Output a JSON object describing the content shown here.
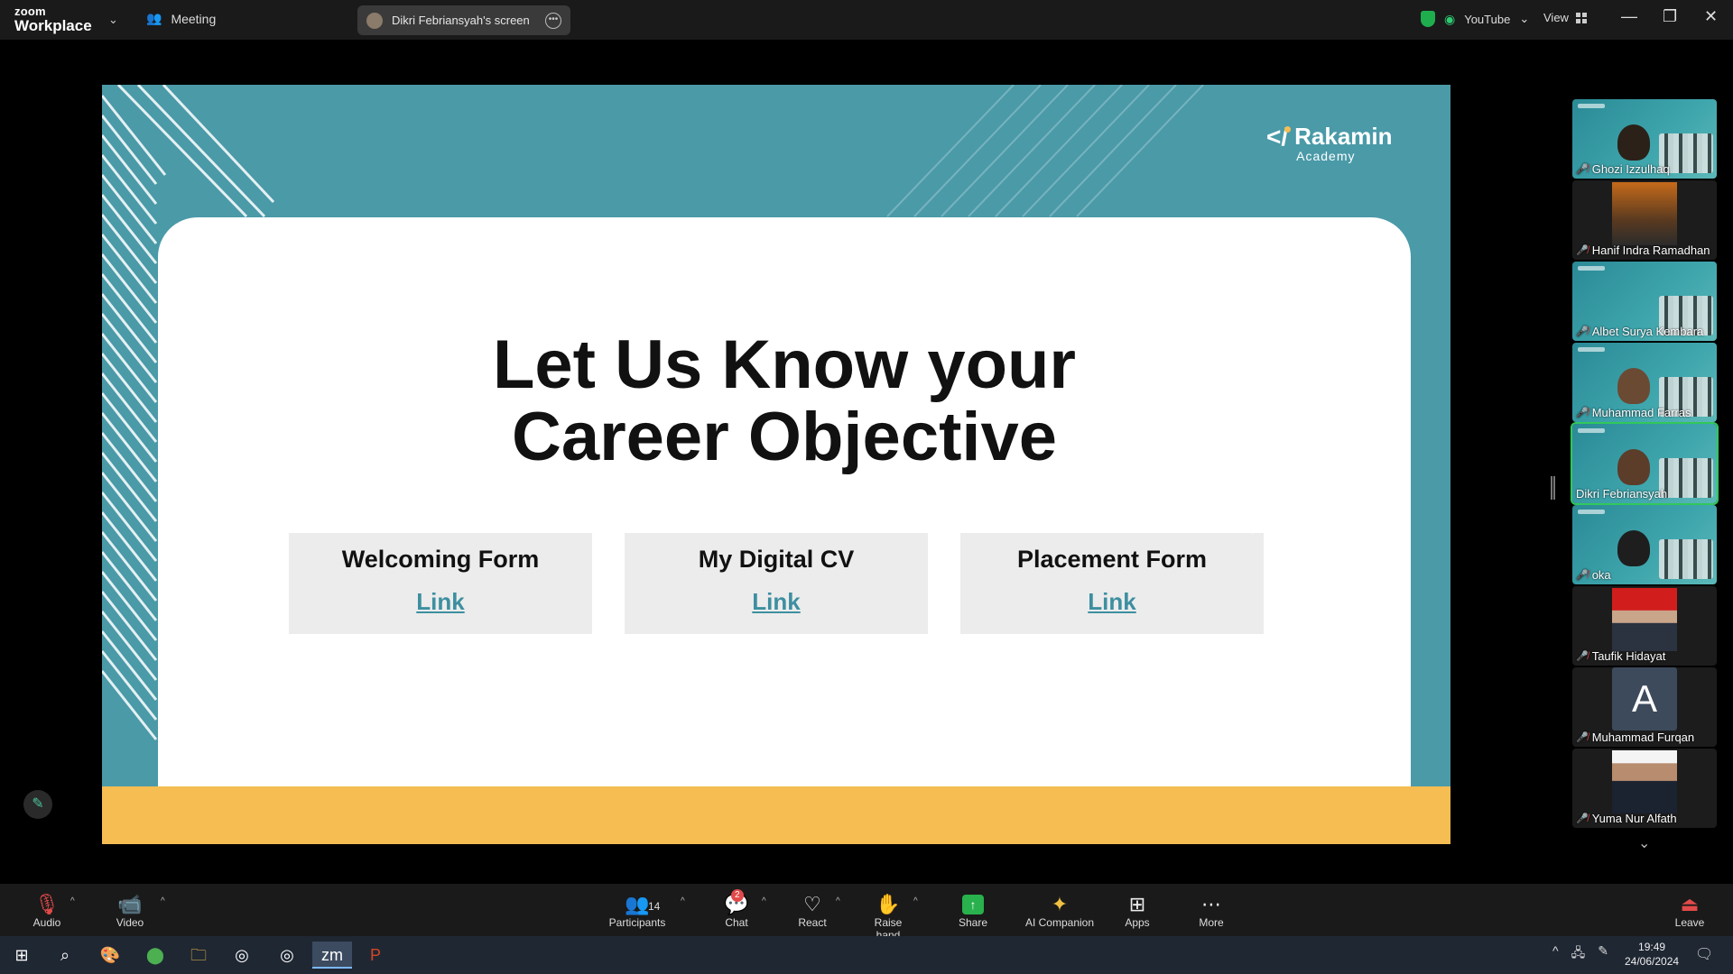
{
  "app": {
    "logo_small": "zoom",
    "logo_big": "Workplace",
    "meeting_label": "Meeting",
    "share_label": "Dikri Febriansyah's screen",
    "youtube_label": "YouTube",
    "view_label": "View"
  },
  "slide": {
    "logo_title": "Rakamin",
    "logo_subtitle": "Academy",
    "headline_line1": "Let Us Know your",
    "headline_line2": "Career Objective",
    "forms": [
      {
        "title": "Welcoming Form",
        "link": "Link"
      },
      {
        "title": "My Digital CV",
        "link": "Link"
      },
      {
        "title": "Placement Form",
        "link": "Link"
      }
    ],
    "colors": {
      "teal": "#4a9aa8",
      "yellow": "#f5bd52",
      "link": "#3d8fa0"
    }
  },
  "participants": [
    {
      "name": "Ghozi Izzulhaq",
      "muted": true
    },
    {
      "name": "Hanif Indra Ramadhan",
      "muted": true
    },
    {
      "name": "Albet Surya Kembara",
      "muted": true
    },
    {
      "name": "Muhammad Farras",
      "muted": true
    },
    {
      "name": "Dikri Febriansyah",
      "muted": false,
      "active": true
    },
    {
      "name": "oka",
      "muted": true
    },
    {
      "name": "Taufik Hidayat",
      "muted": true
    },
    {
      "name": "Muhammad Furqan",
      "muted": true,
      "avatar_letter": "A"
    },
    {
      "name": "Yuma Nur Alfath",
      "muted": true
    }
  ],
  "toolbar": {
    "audio": "Audio",
    "video": "Video",
    "participants": "Participants",
    "participants_count": "14",
    "chat": "Chat",
    "chat_badge": "2",
    "react": "React",
    "raise_hand": "Raise hand",
    "share": "Share",
    "ai_companion": "AI Companion",
    "apps": "Apps",
    "more": "More",
    "leave": "Leave"
  },
  "taskbar": {
    "time": "19:49",
    "date": "24/06/2024"
  }
}
